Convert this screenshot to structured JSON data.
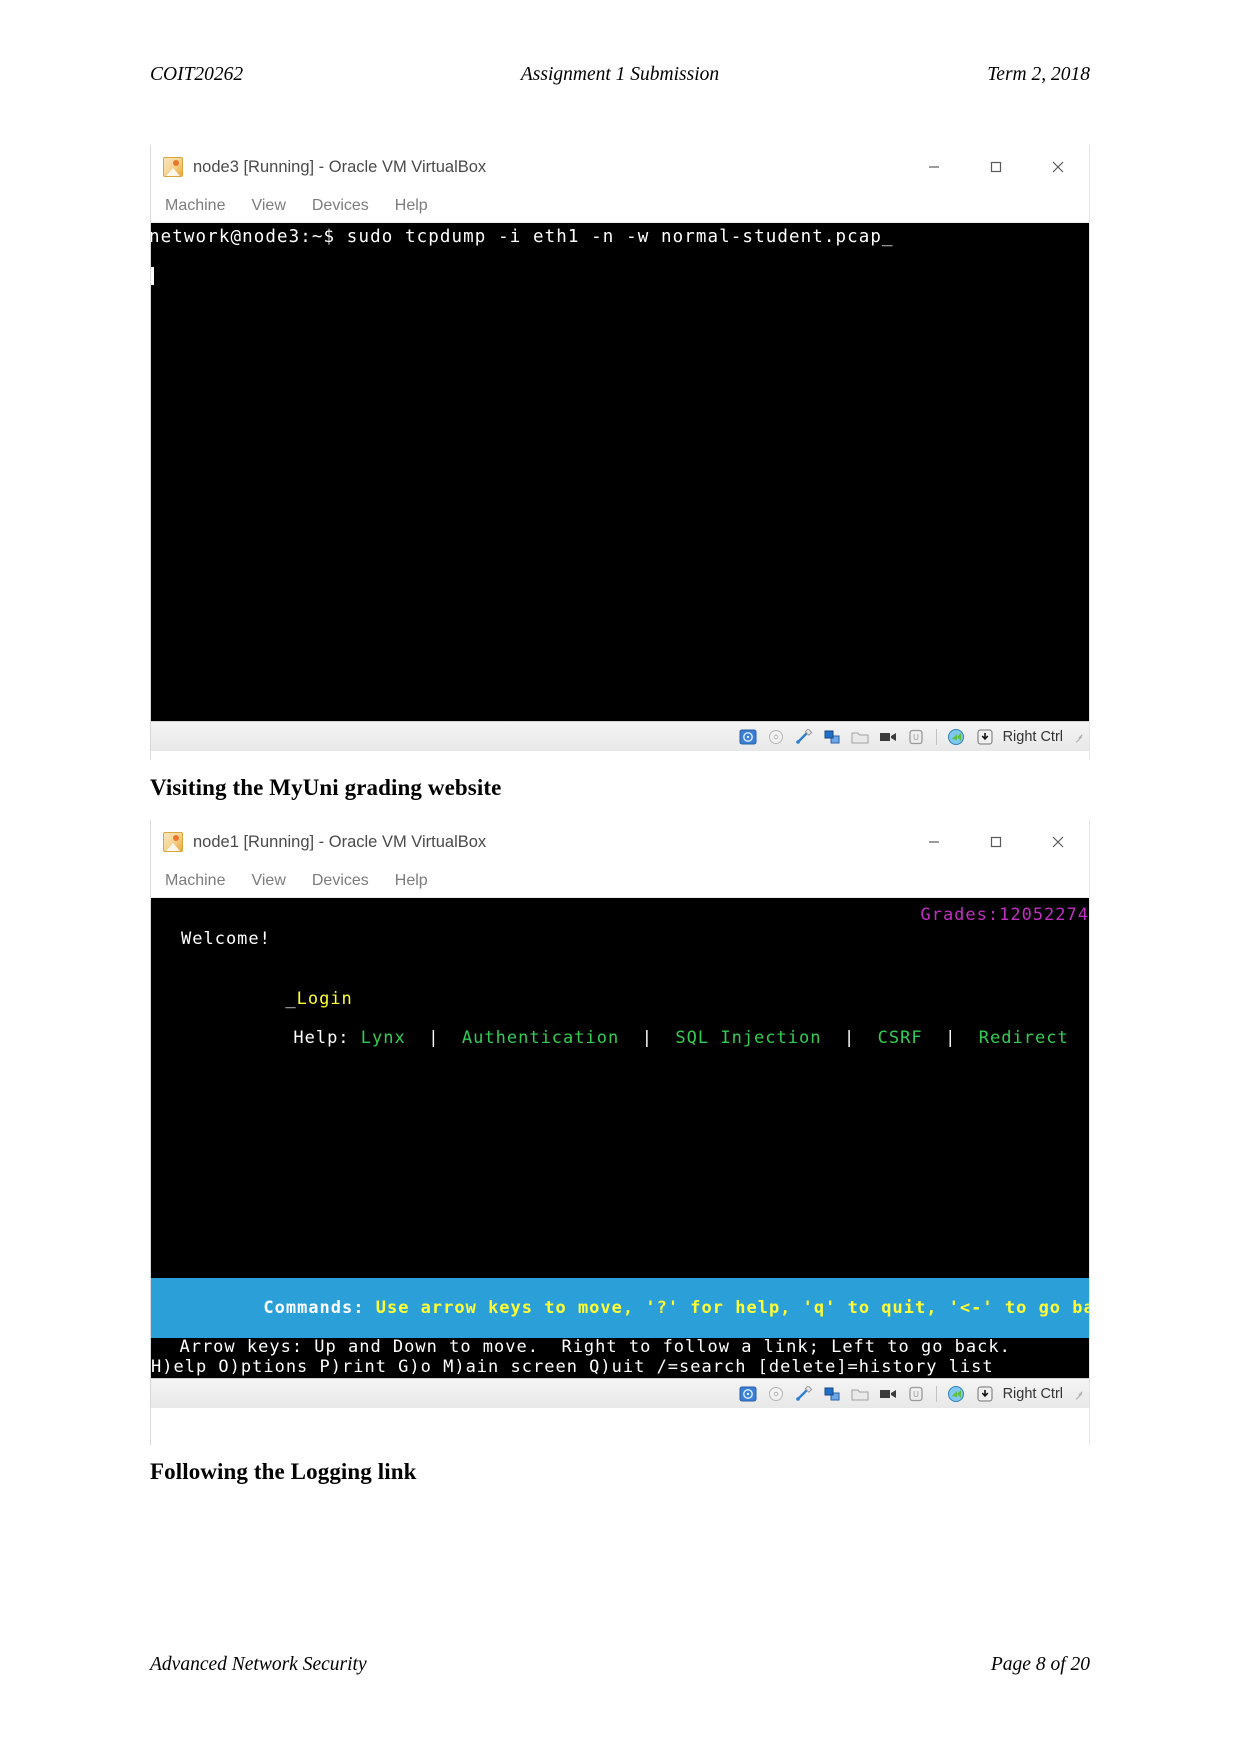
{
  "document": {
    "header": {
      "left": "COIT20262",
      "center": "Assignment 1 Submission",
      "right": "Term 2, 2018"
    },
    "footer": {
      "left": "Advanced Network Security",
      "right": "Page 8 of 20"
    },
    "captions": {
      "caption_1": "Visiting the MyUni grading website",
      "caption_2": "Following the Logging link"
    }
  },
  "window_1": {
    "title": "node3 [Running] - Oracle VM VirtualBox",
    "app_icon": "virtualbox-icon",
    "window_controls": {
      "minimize": "minimize-icon",
      "maximize": "maximize-icon",
      "close": "close-icon"
    },
    "menu": [
      {
        "label": "Machine"
      },
      {
        "label": "View"
      },
      {
        "label": "Devices"
      },
      {
        "label": "Help"
      }
    ],
    "terminal": {
      "line_1": "network@node3:~$ sudo tcpdump -i eth1 -n -w normal-student.pcap_"
    },
    "statusbar": {
      "icons": [
        "hard-disk-icon",
        "optical-disk-icon",
        "usb-icon",
        "network-icon",
        "shared-folders-icon",
        "video-capture-icon",
        "guest-additions-icon",
        "remote-display-icon",
        "host-key-icon"
      ],
      "host_key": "Right Ctrl",
      "resize_grip": "resize-grip-icon"
    }
  },
  "window_2": {
    "title": "node1 [Running] - Oracle VM VirtualBox",
    "app_icon": "virtualbox-icon",
    "window_controls": {
      "minimize": "minimize-icon",
      "maximize": "maximize-icon",
      "close": "close-icon"
    },
    "menu": [
      {
        "label": "Machine"
      },
      {
        "label": "View"
      },
      {
        "label": "Devices"
      },
      {
        "label": "Help"
      }
    ],
    "lynx": {
      "page_title": "Grades:12052274",
      "heading": "Welcome!",
      "login_caret": "_",
      "login_link": "Login",
      "help_label": "Help: ",
      "help_links": [
        "Lynx",
        "Authentication",
        "SQL Injection",
        "CSRF",
        "Redirect"
      ],
      "help_separator": "  |  ",
      "status_prefix": "Commands:",
      "status_text": " Use arrow keys to move, '?' for help, 'q' to quit, '<-' to go back.",
      "help_line_1": "  Arrow keys: Up and Down to move.  Right to follow a link; Left to go back.",
      "help_line_2": "H)elp O)ptions P)rint G)o M)ain screen Q)uit /=search [delete]=history list",
      "colors": {
        "title": "#c030c0",
        "login_link": "#ffff33",
        "help_link": "#33cc55",
        "status_bg": "#2b9fd8",
        "status_fg": "#ffff33"
      }
    },
    "statusbar": {
      "icons": [
        "hard-disk-icon",
        "optical-disk-icon",
        "usb-icon",
        "network-icon",
        "shared-folders-icon",
        "video-capture-icon",
        "guest-additions-icon",
        "remote-display-icon",
        "host-key-icon"
      ],
      "host_key": "Right Ctrl",
      "resize_grip": "resize-grip-icon"
    }
  }
}
